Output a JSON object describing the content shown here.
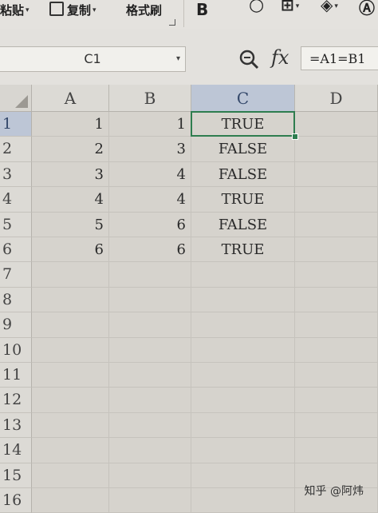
{
  "ribbon": {
    "paste_label": "粘贴",
    "copy_label": "复制",
    "format_painter_label": "格式刷",
    "bold_label": "B",
    "icons": [
      "paste-icon",
      "copy-icon",
      "bold-icon",
      "font-color-icon",
      "border-icon",
      "fill-color-icon"
    ]
  },
  "formula_bar": {
    "name_box": "C1",
    "fx_label": "fx",
    "formula": "=A1=B1"
  },
  "sheet": {
    "columns": [
      "A",
      "B",
      "C",
      "D"
    ],
    "row_numbers": [
      "1",
      "2",
      "3",
      "4",
      "5",
      "6",
      "7",
      "8",
      "9",
      "10",
      "11",
      "12",
      "13",
      "14",
      "15",
      "16"
    ],
    "rows": [
      {
        "A": "1",
        "B": "1",
        "C": "TRUE"
      },
      {
        "A": "2",
        "B": "3",
        "C": "FALSE"
      },
      {
        "A": "3",
        "B": "4",
        "C": "FALSE"
      },
      {
        "A": "4",
        "B": "4",
        "C": "TRUE"
      },
      {
        "A": "5",
        "B": "6",
        "C": "FALSE"
      },
      {
        "A": "6",
        "B": "6",
        "C": "TRUE"
      }
    ],
    "selected_cell": "C1",
    "selection_color": "#2e7d4f",
    "header_highlight": "#bdc6d6"
  },
  "watermark": "知乎 @阿炜"
}
